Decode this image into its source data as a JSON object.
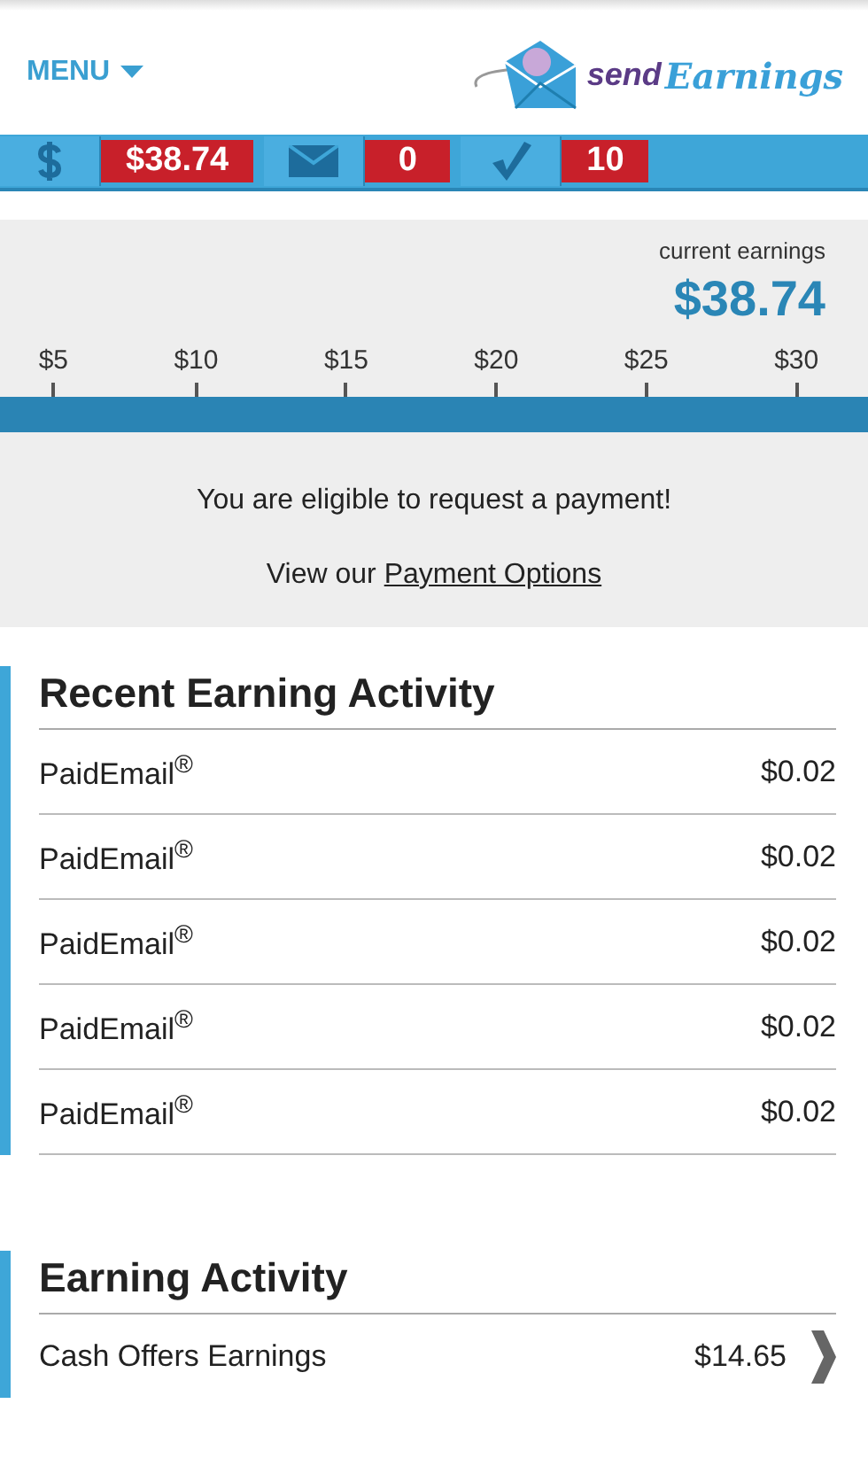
{
  "header": {
    "menu": "MENU",
    "logo": {
      "part1": "send",
      "part2": "Earnings"
    }
  },
  "stats": [
    {
      "kind": "dollar",
      "value": "$38.74"
    },
    {
      "kind": "mail",
      "value": "0"
    },
    {
      "kind": "check",
      "value": "10"
    }
  ],
  "earnings": {
    "label": "current earnings",
    "amount": "$38.74",
    "ticks": [
      "$5",
      "$10",
      "$15",
      "$20",
      "$25",
      "$30"
    ],
    "level": 1,
    "message": "You are eligible to request a payment!",
    "link_prefix": "View our",
    "link": "Payment Options"
  },
  "sections": [
    {
      "title": "Recent Earning Activity",
      "rows": [
        {
          "label": "PaidEmail$^{®}$",
          "amount": "$0.02"
        },
        {
          "label": "PaidEmail$^{®}$",
          "amount": "$0.02"
        },
        {
          "label": "PaidEmail$^{®}$",
          "amount": "$0.02"
        },
        {
          "label": "PaidEmail$^{®}$",
          "amount": "$0.02"
        },
        {
          "label": "PaidEmail$^{®}$",
          "amount": "$0.02"
        }
      ]
    },
    {
      "title": "Earning Activity",
      "rows": [
        {
          "label": "Cash Offers Earnings",
          "amount": "$14.65",
          "chevron": true
        }
      ]
    }
  ]
}
